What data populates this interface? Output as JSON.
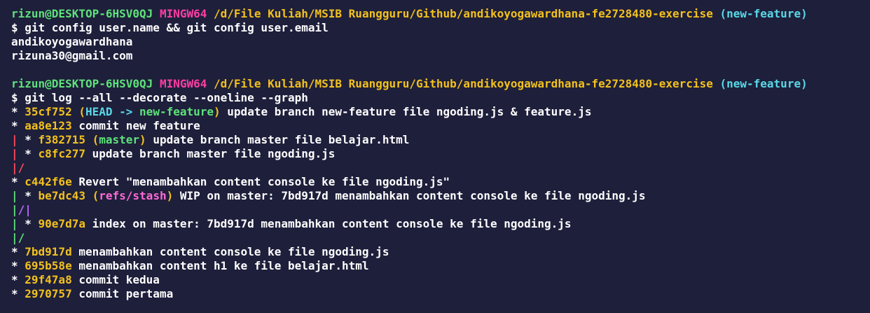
{
  "terminal": {
    "lines": [
      {
        "type": "prompt",
        "segments": [
          {
            "cls": "seg-user",
            "text": "rizun@DESKTOP-6HSV0QJ"
          },
          {
            "cls": "seg-text",
            "text": " "
          },
          {
            "cls": "seg-mingw",
            "text": "MINGW64"
          },
          {
            "cls": "seg-text",
            "text": " "
          },
          {
            "cls": "seg-path",
            "text": "/d/File Kuliah/MSIB Ruangguru/Github/andikoyogawardhana-fe2728480-exercise"
          },
          {
            "cls": "seg-text",
            "text": " "
          },
          {
            "cls": "seg-branch",
            "text": "(new-feature)"
          }
        ]
      },
      {
        "type": "command",
        "segments": [
          {
            "cls": "seg-prompt",
            "text": "$ git config user.name && git config user.email"
          }
        ]
      },
      {
        "type": "output",
        "segments": [
          {
            "cls": "seg-text",
            "text": "andikoyogawardhana"
          }
        ]
      },
      {
        "type": "output",
        "segments": [
          {
            "cls": "seg-text",
            "text": "rizuna30@gmail.com"
          }
        ]
      },
      {
        "type": "blank",
        "segments": [
          {
            "cls": "seg-text",
            "text": ""
          }
        ]
      },
      {
        "type": "prompt",
        "segments": [
          {
            "cls": "seg-user",
            "text": "rizun@DESKTOP-6HSV0QJ"
          },
          {
            "cls": "seg-text",
            "text": " "
          },
          {
            "cls": "seg-mingw",
            "text": "MINGW64"
          },
          {
            "cls": "seg-text",
            "text": " "
          },
          {
            "cls": "seg-path",
            "text": "/d/File Kuliah/MSIB Ruangguru/Github/andikoyogawardhana-fe2728480-exercise"
          },
          {
            "cls": "seg-text",
            "text": " "
          },
          {
            "cls": "seg-branch",
            "text": "(new-feature)"
          }
        ]
      },
      {
        "type": "command",
        "segments": [
          {
            "cls": "seg-prompt",
            "text": "$ git log --all --decorate --oneline --graph"
          }
        ]
      },
      {
        "type": "log",
        "segments": [
          {
            "cls": "seg-graph-star",
            "text": "* "
          },
          {
            "cls": "seg-hash",
            "text": "35cf752"
          },
          {
            "cls": "seg-text",
            "text": " "
          },
          {
            "cls": "seg-paren",
            "text": "("
          },
          {
            "cls": "seg-head",
            "text": "HEAD -> "
          },
          {
            "cls": "seg-localbranch",
            "text": "new-feature"
          },
          {
            "cls": "seg-paren",
            "text": ")"
          },
          {
            "cls": "seg-text",
            "text": " update branch new-feature file ngoding.js & feature.js"
          }
        ]
      },
      {
        "type": "log",
        "segments": [
          {
            "cls": "seg-graph-star",
            "text": "* "
          },
          {
            "cls": "seg-hash",
            "text": "aa8e123"
          },
          {
            "cls": "seg-text",
            "text": " commit new feature"
          }
        ]
      },
      {
        "type": "log",
        "segments": [
          {
            "cls": "seg-graph-red",
            "text": "| "
          },
          {
            "cls": "seg-graph-star",
            "text": "* "
          },
          {
            "cls": "seg-hash",
            "text": "f382715"
          },
          {
            "cls": "seg-text",
            "text": " "
          },
          {
            "cls": "seg-paren",
            "text": "("
          },
          {
            "cls": "seg-master",
            "text": "master"
          },
          {
            "cls": "seg-paren",
            "text": ")"
          },
          {
            "cls": "seg-text",
            "text": " update branch master file belajar.html"
          }
        ]
      },
      {
        "type": "log",
        "segments": [
          {
            "cls": "seg-graph-red",
            "text": "| "
          },
          {
            "cls": "seg-graph-star",
            "text": "* "
          },
          {
            "cls": "seg-hash",
            "text": "c8fc277"
          },
          {
            "cls": "seg-text",
            "text": " update branch master file ngoding.js"
          }
        ]
      },
      {
        "type": "log",
        "segments": [
          {
            "cls": "seg-graph-red",
            "text": "|/"
          }
        ]
      },
      {
        "type": "log",
        "segments": [
          {
            "cls": "seg-graph-star",
            "text": "* "
          },
          {
            "cls": "seg-hash",
            "text": "c442f6e"
          },
          {
            "cls": "seg-text",
            "text": " Revert \"menambahkan content console ke file ngoding.js\""
          }
        ]
      },
      {
        "type": "log",
        "segments": [
          {
            "cls": "seg-graph-green",
            "text": "| "
          },
          {
            "cls": "seg-graph-star",
            "text": "* "
          },
          {
            "cls": "seg-hash",
            "text": "be7dc43"
          },
          {
            "cls": "seg-text",
            "text": " "
          },
          {
            "cls": "seg-paren",
            "text": "("
          },
          {
            "cls": "seg-stash",
            "text": "refs/stash"
          },
          {
            "cls": "seg-paren",
            "text": ")"
          },
          {
            "cls": "seg-text",
            "text": " WIP on master: 7bd917d menambahkan content console ke file ngoding.js"
          }
        ]
      },
      {
        "type": "log",
        "segments": [
          {
            "cls": "seg-graph-green",
            "text": "|"
          },
          {
            "cls": "seg-graph-purple",
            "text": "/|"
          }
        ]
      },
      {
        "type": "log",
        "segments": [
          {
            "cls": "seg-graph-green",
            "text": "| "
          },
          {
            "cls": "seg-graph-star",
            "text": "* "
          },
          {
            "cls": "seg-hash",
            "text": "90e7d7a"
          },
          {
            "cls": "seg-text",
            "text": " index on master: 7bd917d menambahkan content console ke file ngoding.js"
          }
        ]
      },
      {
        "type": "log",
        "segments": [
          {
            "cls": "seg-graph-green",
            "text": "|/"
          }
        ]
      },
      {
        "type": "log",
        "segments": [
          {
            "cls": "seg-graph-star",
            "text": "* "
          },
          {
            "cls": "seg-hash",
            "text": "7bd917d"
          },
          {
            "cls": "seg-text",
            "text": " menambahkan content console ke file ngoding.js"
          }
        ]
      },
      {
        "type": "log",
        "segments": [
          {
            "cls": "seg-graph-star",
            "text": "* "
          },
          {
            "cls": "seg-hash",
            "text": "695b58e"
          },
          {
            "cls": "seg-text",
            "text": " menambahkan content h1 ke file belajar.html"
          }
        ]
      },
      {
        "type": "log",
        "segments": [
          {
            "cls": "seg-graph-star",
            "text": "* "
          },
          {
            "cls": "seg-hash",
            "text": "29f47a8"
          },
          {
            "cls": "seg-text",
            "text": " commit kedua"
          }
        ]
      },
      {
        "type": "log",
        "segments": [
          {
            "cls": "seg-graph-star",
            "text": "* "
          },
          {
            "cls": "seg-hash",
            "text": "2970757"
          },
          {
            "cls": "seg-text",
            "text": " commit pertama"
          }
        ]
      }
    ]
  }
}
